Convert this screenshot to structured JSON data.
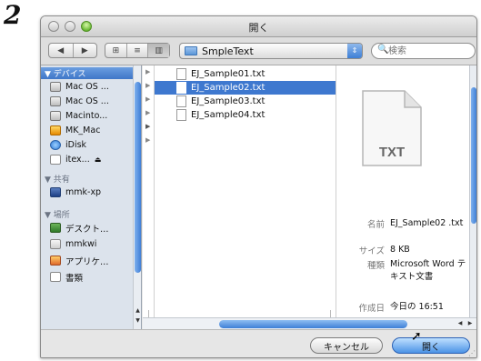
{
  "step_number": "2",
  "window": {
    "title": "開く"
  },
  "toolbar": {
    "back_icon": "◀",
    "forward_icon": "▶",
    "view_icons": [
      "⊞",
      "≡",
      "▥"
    ],
    "location": "SmpleText",
    "search_placeholder": "検索",
    "search_icon": "🔍"
  },
  "sidebar": {
    "devices_heading": "▼ デバイス",
    "devices": [
      {
        "label": "Mac OS ...",
        "icon": "hard-drive"
      },
      {
        "label": "Mac OS ...",
        "icon": "hard-drive"
      },
      {
        "label": "Macinto...",
        "icon": "hard-drive"
      },
      {
        "label": "MK_Mac",
        "icon": "mac-drive"
      },
      {
        "label": "iDisk",
        "icon": "idisk"
      },
      {
        "label": "itex...",
        "icon": "disk",
        "eject": "⏏"
      }
    ],
    "shared_heading": "▼ 共有",
    "shared": [
      {
        "label": "mmk-xp",
        "icon": "pc"
      }
    ],
    "places_heading": "▼ 場所",
    "places": [
      {
        "label": "デスクト…",
        "icon": "desktop"
      },
      {
        "label": "mmkwi",
        "icon": "home"
      },
      {
        "label": "アプリケ…",
        "icon": "applications"
      },
      {
        "label": "書類",
        "icon": "documents"
      }
    ]
  },
  "files": [
    {
      "name": "EJ_Sample01.txt",
      "selected": false
    },
    {
      "name": "EJ_Sample02.txt",
      "selected": true
    },
    {
      "name": "EJ_Sample03.txt",
      "selected": false
    },
    {
      "name": "EJ_Sample04.txt",
      "selected": false
    }
  ],
  "preview": {
    "icon_label": "TXT",
    "rows": [
      {
        "key": "名前",
        "value": "EJ_Sample02 .txt"
      },
      {
        "key": "サイズ",
        "value": "8 KB"
      },
      {
        "key": "種類",
        "value": "Microsoft Word テキスト文書"
      },
      {
        "key": "作成日",
        "value": "今日の 16:51"
      }
    ]
  },
  "buttons": {
    "cancel": "キャンセル",
    "open": "開く"
  },
  "colors": {
    "selection": "#3e78cf",
    "accent": "#3f7fd6"
  }
}
